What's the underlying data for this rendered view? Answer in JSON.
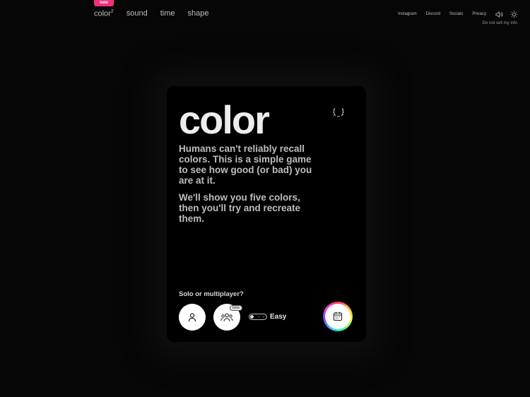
{
  "nav": {
    "badge": "new",
    "links": [
      {
        "label": "color",
        "sup": "2"
      },
      {
        "label": "sound"
      },
      {
        "label": "time"
      },
      {
        "label": "shape"
      }
    ],
    "right_links": [
      "Instagram",
      "Discord",
      "Socials",
      "Privacy"
    ],
    "do_not_sell": "Do not sell my info"
  },
  "card": {
    "title": "color",
    "desc1": "Humans can't reliably recall colors. This is a simple game to see how good (or bad) you are at it.",
    "desc2": "We'll show you five colors, then you'll try and recreate them.",
    "mode_label": "Solo or multiplayer?",
    "beta": "beta",
    "difficulty": "Easy"
  },
  "colors": {
    "background": "#060606",
    "card": "#000000",
    "badge": "#f0307e"
  },
  "icons": [
    "sound-icon",
    "sun-icon",
    "laurel-icon",
    "person-icon",
    "group-icon",
    "calendar-icon"
  ]
}
